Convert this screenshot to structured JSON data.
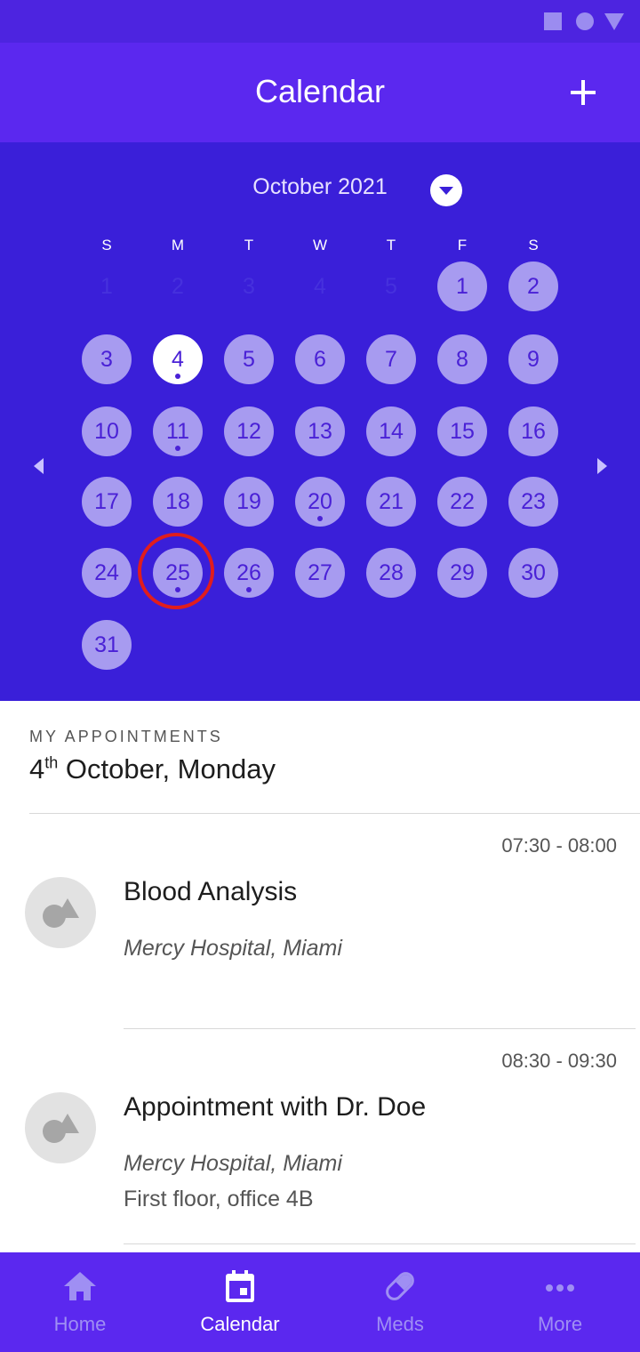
{
  "app": {
    "title": "Calendar"
  },
  "colors": {
    "header": "#5b28ef",
    "calendar_bg": "#3a1fd9",
    "day": "#a79bf0",
    "selected_ring": "#e11d1d"
  },
  "calendar": {
    "month_label": "October 2021",
    "weekdays": [
      "S",
      "M",
      "T",
      "W",
      "T",
      "F",
      "S"
    ],
    "leading_faded_days": [
      "1",
      "2",
      "3",
      "4",
      "5"
    ],
    "days": [
      "1",
      "2",
      "3",
      "4",
      "5",
      "6",
      "7",
      "8",
      "9",
      "10",
      "11",
      "12",
      "13",
      "14",
      "15",
      "16",
      "17",
      "18",
      "19",
      "20",
      "21",
      "22",
      "23",
      "24",
      "25",
      "26",
      "27",
      "28",
      "29",
      "30",
      "31"
    ],
    "today": "4",
    "days_with_appointments": [
      "4",
      "11",
      "20",
      "25",
      "26"
    ],
    "circled_day": "25"
  },
  "appointments": {
    "section_label": "MY APPOINTMENTS",
    "date_day": "4",
    "date_suffix": "th",
    "date_rest": " October, Monday",
    "items": [
      {
        "time": "07:30 - 08:00",
        "title": "Blood Analysis",
        "location": "Mercy Hospital, Miami",
        "extra": ""
      },
      {
        "time": "08:30 - 09:30",
        "title": "Appointment with Dr. Doe",
        "location": "Mercy Hospital, Miami",
        "extra": "First floor, office 4B"
      }
    ]
  },
  "bottom_nav": {
    "items": [
      {
        "label": "Home",
        "icon": "home-icon"
      },
      {
        "label": "Calendar",
        "icon": "calendar-icon"
      },
      {
        "label": "Meds",
        "icon": "pill-icon"
      },
      {
        "label": "More",
        "icon": "more-icon"
      }
    ],
    "active": "Calendar"
  }
}
